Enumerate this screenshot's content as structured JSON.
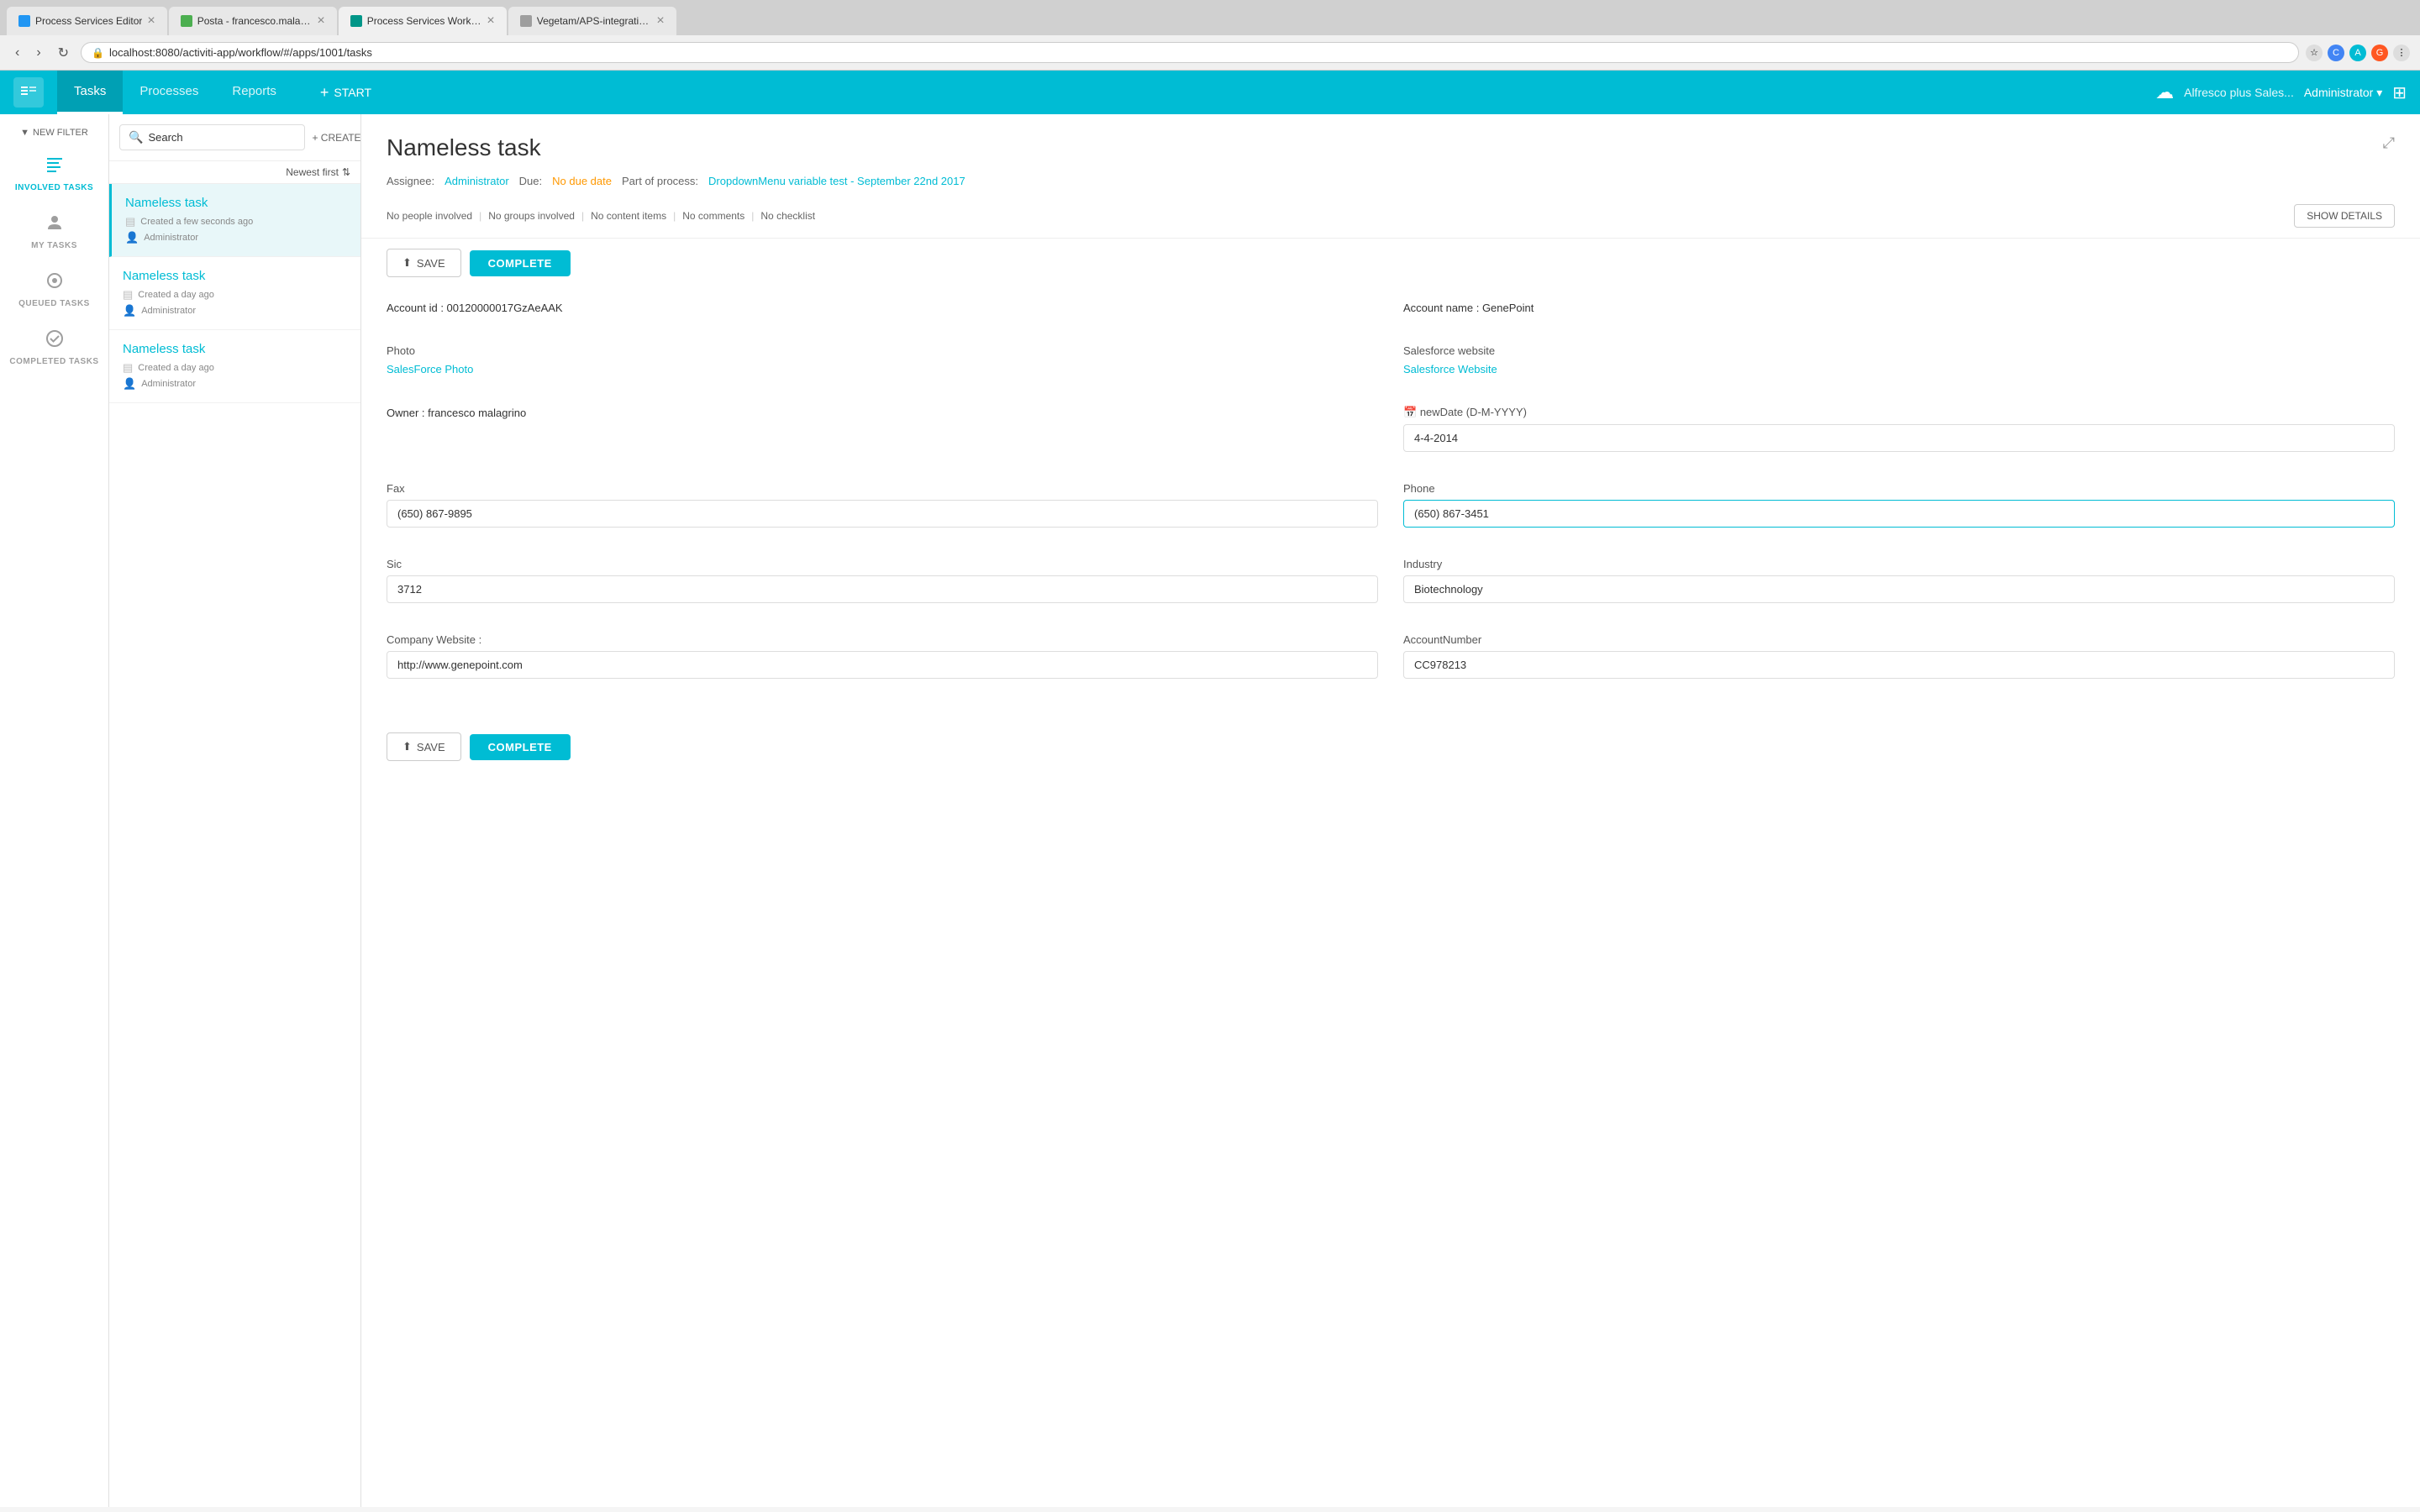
{
  "browser": {
    "tabs": [
      {
        "id": "tab1",
        "title": "Process Services Editor",
        "favicon_color": "#2196F3",
        "active": false
      },
      {
        "id": "tab2",
        "title": "Posta - francesco.malagrino@...",
        "favicon_color": "#4CAF50",
        "active": false
      },
      {
        "id": "tab3",
        "title": "Process Services Workflow",
        "favicon_color": "#009688",
        "active": true
      },
      {
        "id": "tab4",
        "title": "Vegetam/APS-integration-with...",
        "favicon_color": "#9E9E9E",
        "active": false
      }
    ],
    "address": "localhost:8080/activiti-app/workflow/#/apps/1001/tasks"
  },
  "topnav": {
    "tabs": [
      "Tasks",
      "Processes",
      "Reports"
    ],
    "active_tab": "Tasks",
    "start_label": "START",
    "app_name": "Alfresco plus Sales...",
    "user": "Administrator"
  },
  "sidebar": {
    "filter_label": "NEW FILTER",
    "items": [
      {
        "id": "involved",
        "label": "INVOLVED TASKS",
        "icon": "≡"
      },
      {
        "id": "my",
        "label": "MY TASKS",
        "icon": "👤"
      },
      {
        "id": "queued",
        "label": "QUEUED TASKS",
        "icon": "◎"
      },
      {
        "id": "completed",
        "label": "COMPLETED TASKS",
        "icon": "✓"
      }
    ],
    "active_item": "involved"
  },
  "task_list": {
    "search_placeholder": "Search",
    "create_task_label": "+ CREATE TASK",
    "sort_label": "Newest first",
    "tasks": [
      {
        "id": "task1",
        "name": "Nameless task",
        "created": "Created a few seconds ago",
        "user": "Administrator",
        "selected": true
      },
      {
        "id": "task2",
        "name": "Nameless task",
        "created": "Created a day ago",
        "user": "Administrator",
        "selected": false
      },
      {
        "id": "task3",
        "name": "Nameless task",
        "created": "Created a day ago",
        "user": "Administrator",
        "selected": false
      }
    ]
  },
  "task_detail": {
    "title": "Nameless task",
    "assignee_label": "Assignee:",
    "assignee": "Administrator",
    "due_label": "Due:",
    "due": "No due date",
    "process_label": "Part of process:",
    "process": "DropdownMenu variable test - September 22nd 2017",
    "badges": {
      "people": "No people involved",
      "groups": "No groups involved",
      "content": "No content items",
      "comments": "No comments",
      "checklist": "No checklist"
    },
    "show_details_label": "SHOW DETAILS",
    "save_label": "SAVE",
    "complete_label": "COMPLETE",
    "fields": {
      "account_id_label": "Account id : 00120000017GzAeAAK",
      "account_name_label": "Account name : GenePoint",
      "photo_label": "Photo",
      "photo_link": "SalesForce Photo",
      "salesforce_website_label": "Salesforce website",
      "salesforce_website_link": "Salesforce Website",
      "owner_label": "Owner : francesco malagrino",
      "new_date_label": "newDate (D-M-YYYY)",
      "new_date_value": "4-4-2014",
      "fax_label": "Fax",
      "fax_value": "(650) 867-9895",
      "phone_label": "Phone",
      "phone_value": "(650) 867-3451",
      "sic_label": "Sic",
      "sic_value": "3712",
      "industry_label": "Industry",
      "industry_value": "Biotechnology",
      "company_website_label": "Company Website :",
      "company_website_value": "http://www.genepoint.com",
      "account_number_label": "AccountNumber",
      "account_number_value": "CC978213"
    }
  },
  "icons": {
    "search": "🔍",
    "filter": "▼",
    "sort": "⇅",
    "list": "▤",
    "user": "👤",
    "save": "⬆",
    "expand": "⤢",
    "calendar": "📅",
    "cloud": "☁",
    "grid": "⊞",
    "plus": "+",
    "close": "×",
    "lock": "🔒"
  },
  "colors": {
    "teal": "#00BCD4",
    "teal_dark": "#00ACC1",
    "orange": "#FF9800",
    "sidebar_text": "#9e9e9e",
    "text_dark": "#333",
    "text_mid": "#666",
    "border": "#e0e0e0"
  }
}
